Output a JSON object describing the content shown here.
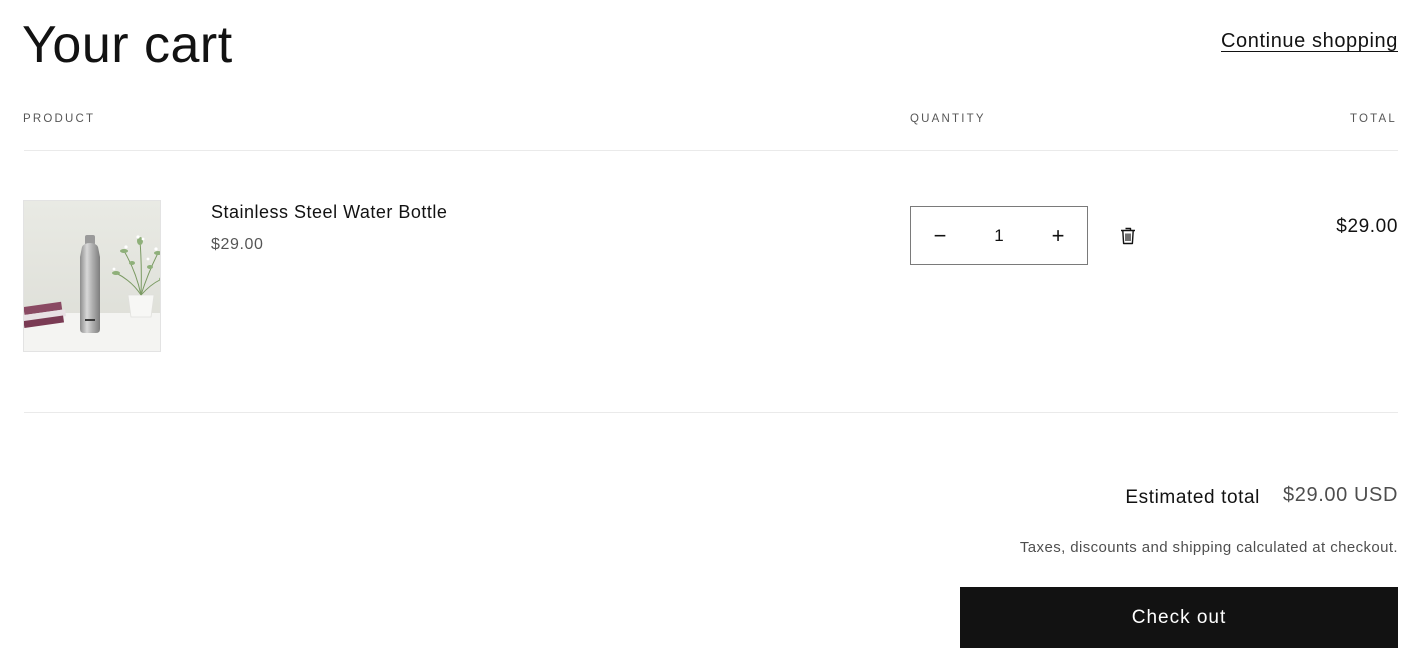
{
  "header": {
    "title": "Your cart",
    "continue_label": "Continue shopping"
  },
  "table": {
    "columns": [
      "PRODUCT",
      "QUANTITY",
      "TOTAL"
    ]
  },
  "items": [
    {
      "name": "Stainless Steel Water Bottle",
      "price": "$29.00",
      "quantity": "1",
      "decrease_symbol": "−",
      "increase_symbol": "+",
      "line_total": "$29.00"
    }
  ],
  "summary": {
    "estimated_label": "Estimated total",
    "estimated_value": "$29.00 USD",
    "tax_note": "Taxes, discounts and shipping calculated at checkout.",
    "checkout_label": "Check out"
  },
  "icons": {
    "remove": "trash-icon",
    "decrease": "minus-icon",
    "increase": "plus-icon"
  },
  "colors": {
    "text": "#121212",
    "button_bg": "#121212",
    "button_text": "#ffffff"
  }
}
